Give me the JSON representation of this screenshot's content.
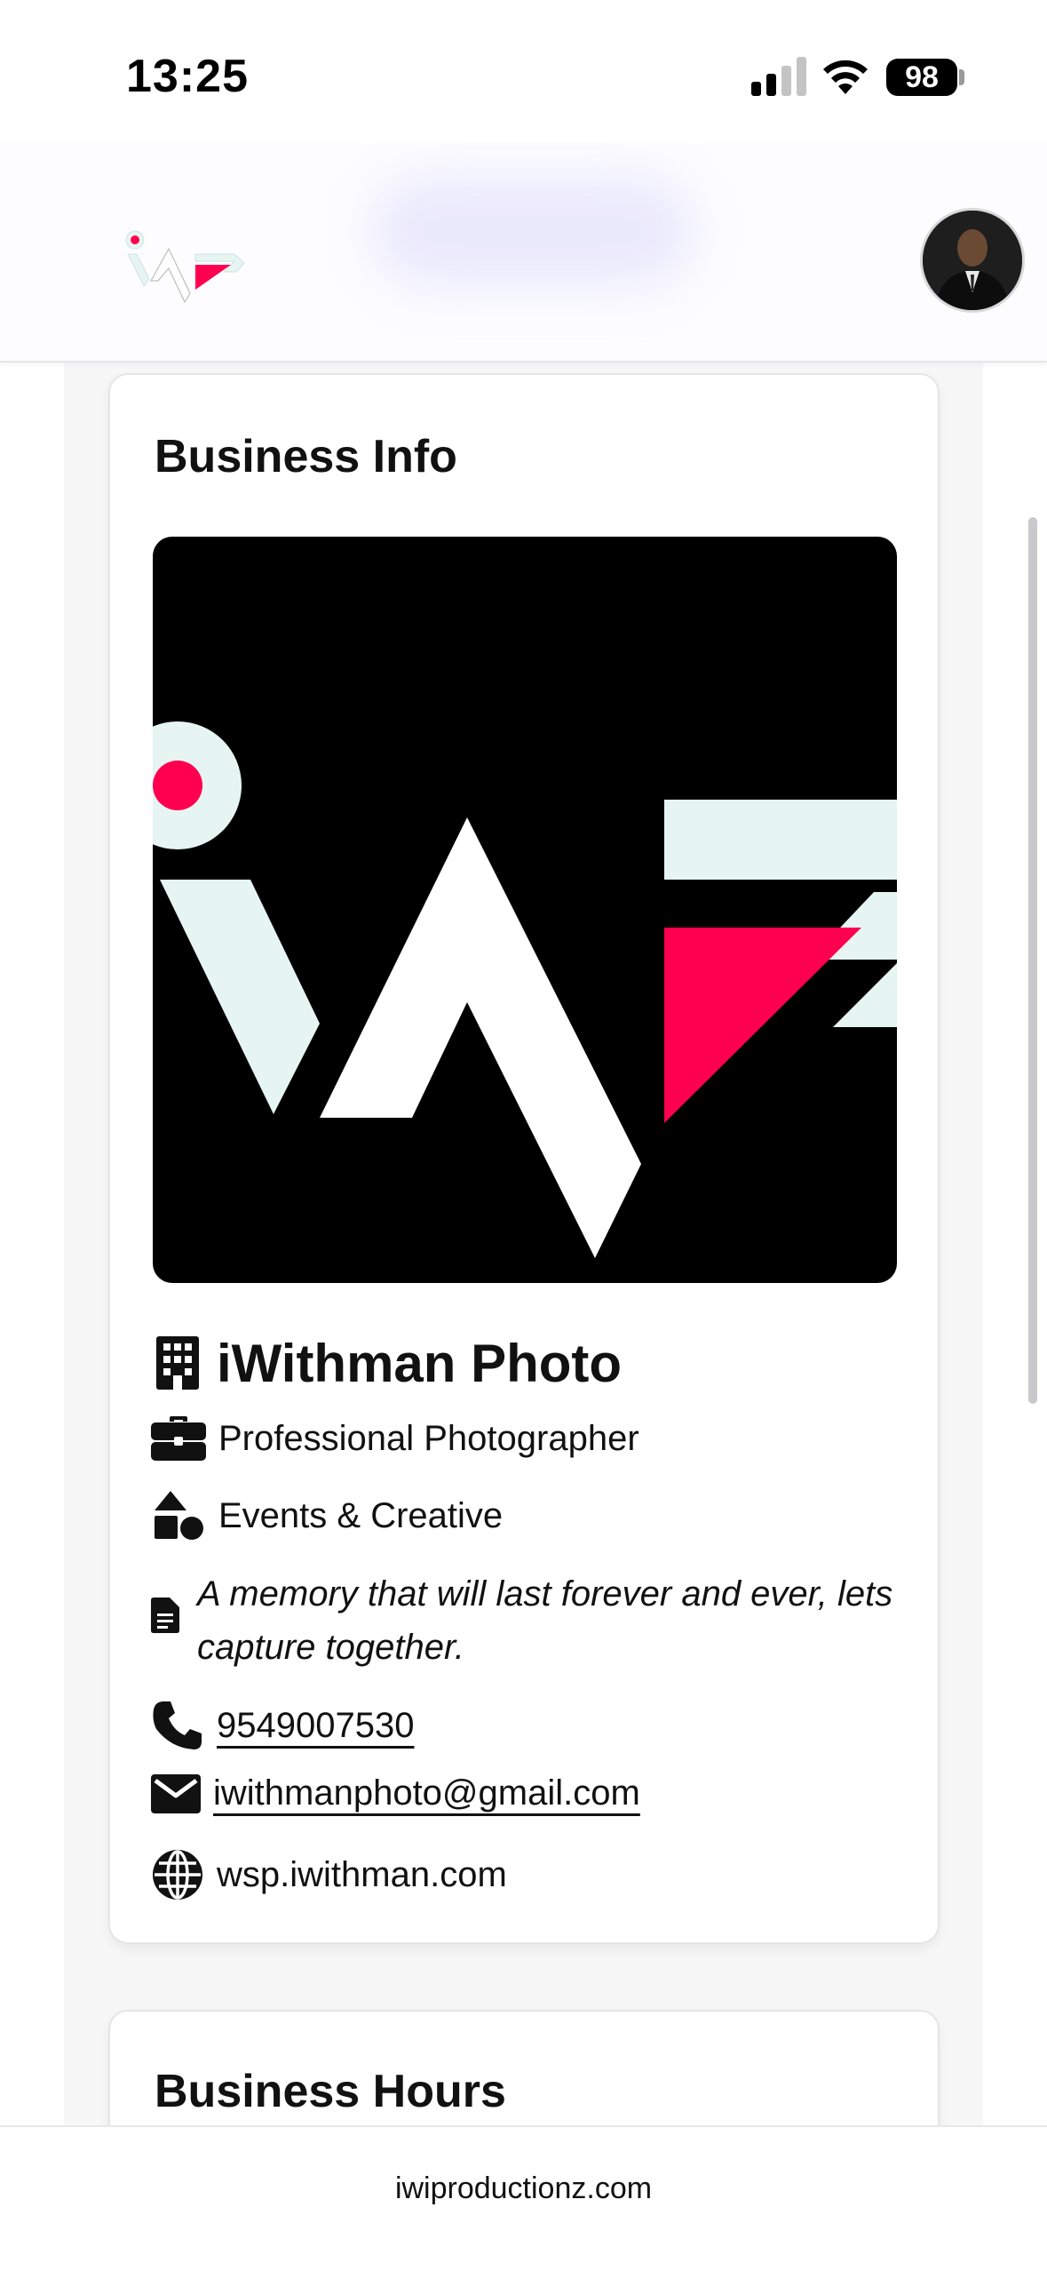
{
  "status_bar": {
    "time": "13:25",
    "battery": "98"
  },
  "header": {
    "logo_icon": "iwp-logo",
    "avatar_icon": "profile-avatar"
  },
  "business_info": {
    "title": "Business Info",
    "name": "iWithman Photo",
    "role": "Professional Photographer",
    "category": "Events & Creative",
    "tagline": "A memory that will last forever and ever, lets capture together.",
    "phone": "9549007530",
    "email": "iwithmanphoto@gmail.com",
    "website": "wsp.iwithman.com"
  },
  "business_hours": {
    "title": "Business Hours"
  },
  "footer": {
    "text": "iwiproductionz.com"
  },
  "colors": {
    "brand_pink": "#ff0050",
    "brand_mint": "#e6f5f2",
    "black": "#000000"
  }
}
